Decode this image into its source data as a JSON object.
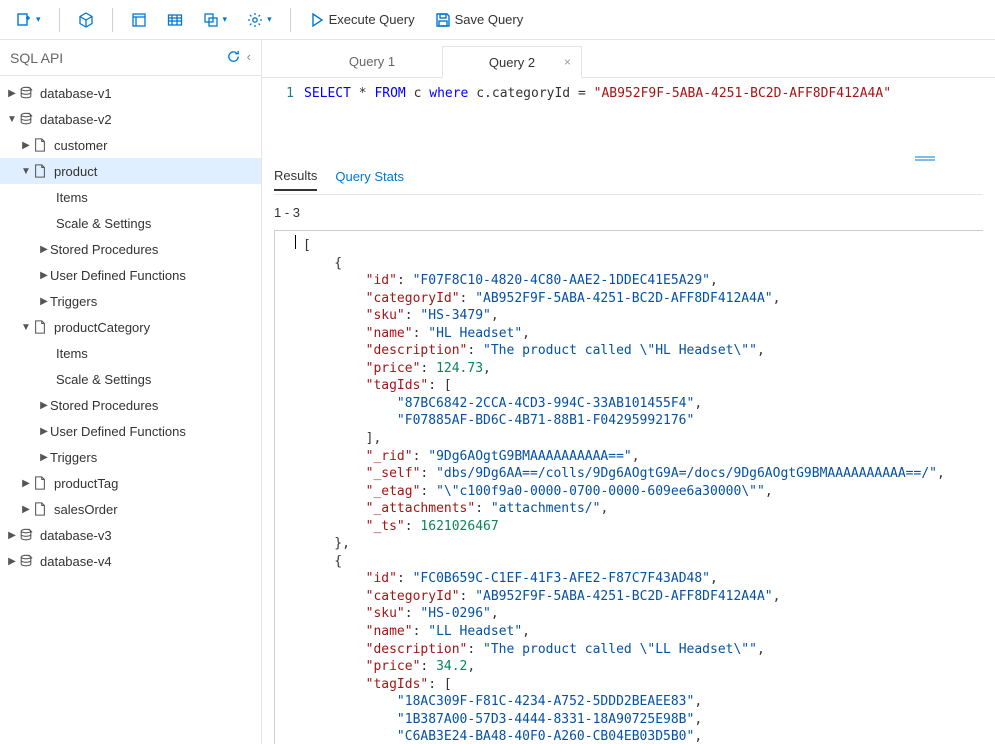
{
  "toolbar": {
    "execute_label": "Execute Query",
    "save_label": "Save Query"
  },
  "sidebar": {
    "title": "SQL API",
    "nodes": [
      {
        "level": 0,
        "caret": "right",
        "icon": "db",
        "label": "database-v1"
      },
      {
        "level": 0,
        "caret": "down",
        "icon": "db",
        "label": "database-v2"
      },
      {
        "level": 1,
        "caret": "right",
        "icon": "doc",
        "label": "customer"
      },
      {
        "level": 1,
        "caret": "down",
        "icon": "doc",
        "label": "product",
        "selected": true
      },
      {
        "level": 2,
        "caret": "none",
        "icon": "",
        "label": "Items"
      },
      {
        "level": 2,
        "caret": "none",
        "icon": "",
        "label": "Scale & Settings"
      },
      {
        "level": 2,
        "caret": "right",
        "icon": "",
        "label": "Stored Procedures"
      },
      {
        "level": 2,
        "caret": "right",
        "icon": "",
        "label": "User Defined Functions"
      },
      {
        "level": 2,
        "caret": "right",
        "icon": "",
        "label": "Triggers"
      },
      {
        "level": 1,
        "caret": "down",
        "icon": "doc",
        "label": "productCategory"
      },
      {
        "level": 2,
        "caret": "none",
        "icon": "",
        "label": "Items"
      },
      {
        "level": 2,
        "caret": "none",
        "icon": "",
        "label": "Scale & Settings"
      },
      {
        "level": 2,
        "caret": "right",
        "icon": "",
        "label": "Stored Procedures"
      },
      {
        "level": 2,
        "caret": "right",
        "icon": "",
        "label": "User Defined Functions"
      },
      {
        "level": 2,
        "caret": "right",
        "icon": "",
        "label": "Triggers"
      },
      {
        "level": 1,
        "caret": "right",
        "icon": "doc",
        "label": "productTag"
      },
      {
        "level": 1,
        "caret": "right",
        "icon": "doc",
        "label": "salesOrder"
      },
      {
        "level": 0,
        "caret": "right",
        "icon": "db",
        "label": "database-v3"
      },
      {
        "level": 0,
        "caret": "right",
        "icon": "db",
        "label": "database-v4"
      }
    ]
  },
  "tabs": [
    {
      "label": "Query 1",
      "active": false,
      "closable": false
    },
    {
      "label": "Query 2",
      "active": true,
      "closable": true
    }
  ],
  "editor": {
    "line_number": "1",
    "query_html": "<span class='kw'>SELECT</span> <span class='op'>*</span> <span class='kw'>FROM</span> c <span class='kw2'>where</span> c.categoryId <span class='op'>=</span> <span class='str'>\"AB952F9F-5ABA-4251-BC2D-AFF8DF412A4A\"</span>"
  },
  "result_tabs": {
    "results": "Results",
    "stats": "Query Stats"
  },
  "result_range": "1 - 3",
  "result_json_html": "[\n    {\n        <span class='jk'>\"id\"</span>: <span class='js'>\"F07F8C10-4820-4C80-AAE2-1DDEC41E5A29\"</span>,\n        <span class='jk'>\"categoryId\"</span>: <span class='js'>\"AB952F9F-5ABA-4251-BC2D-AFF8DF412A4A\"</span>,\n        <span class='jk'>\"sku\"</span>: <span class='js'>\"HS-3479\"</span>,\n        <span class='jk'>\"name\"</span>: <span class='js'>\"HL Headset\"</span>,\n        <span class='jk'>\"description\"</span>: <span class='js'>\"The product called \\\"HL Headset\\\"\"</span>,\n        <span class='jk'>\"price\"</span>: <span class='jn'>124.73</span>,\n        <span class='jk'>\"tagIds\"</span>: [\n            <span class='js'>\"87BC6842-2CCA-4CD3-994C-33AB101455F4\"</span>,\n            <span class='js'>\"F07885AF-BD6C-4B71-88B1-F04295992176\"</span>\n        ],\n        <span class='jk'>\"_rid\"</span>: <span class='js'>\"9Dg6AOgtG9BMAAAAAAAAAA==\"</span>,\n        <span class='jk'>\"_self\"</span>: <span class='js'>\"dbs/9Dg6AA==/colls/9Dg6AOgtG9A=/docs/9Dg6AOgtG9BMAAAAAAAAAA==/\"</span>,\n        <span class='jk'>\"_etag\"</span>: <span class='js'>\"\\\"c100f9a0-0000-0700-0000-609ee6a30000\\\"\"</span>,\n        <span class='jk'>\"_attachments\"</span>: <span class='js'>\"attachments/\"</span>,\n        <span class='jk'>\"_ts\"</span>: <span class='jn'>1621026467</span>\n    },\n    {\n        <span class='jk'>\"id\"</span>: <span class='js'>\"FC0B659C-C1EF-41F3-AFE2-F87C7F43AD48\"</span>,\n        <span class='jk'>\"categoryId\"</span>: <span class='js'>\"AB952F9F-5ABA-4251-BC2D-AFF8DF412A4A\"</span>,\n        <span class='jk'>\"sku\"</span>: <span class='js'>\"HS-0296\"</span>,\n        <span class='jk'>\"name\"</span>: <span class='js'>\"LL Headset\"</span>,\n        <span class='jk'>\"description\"</span>: <span class='js'>\"The product called \\\"LL Headset\\\"\"</span>,\n        <span class='jk'>\"price\"</span>: <span class='jn'>34.2</span>,\n        <span class='jk'>\"tagIds\"</span>: [\n            <span class='js'>\"18AC309F-F81C-4234-A752-5DDD2BEAEE83\"</span>,\n            <span class='js'>\"1B387A00-57D3-4444-8331-18A90725E98B\"</span>,\n            <span class='js'>\"C6AB3E24-BA48-40F0-A260-CB04EB03D5B0\"</span>,"
}
